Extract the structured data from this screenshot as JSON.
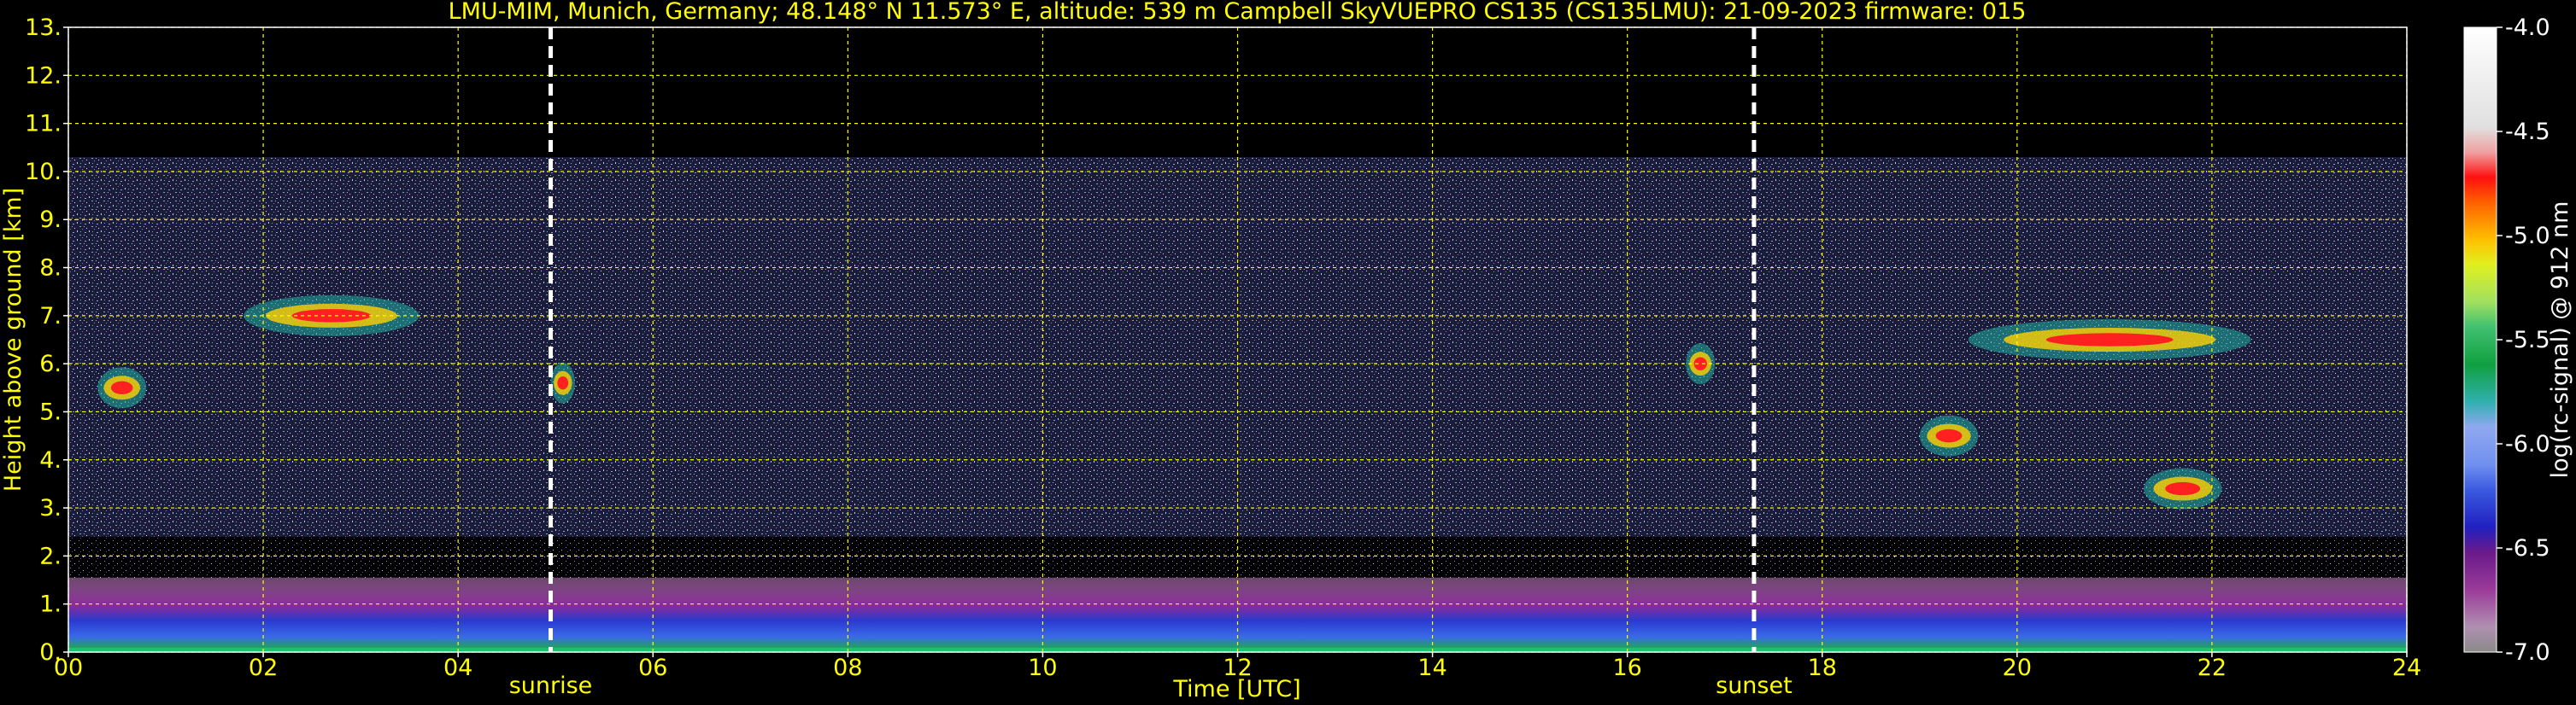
{
  "chart_data": {
    "type": "heatmap",
    "title": "LMU-MIM, Munich, Germany; 48.148° N 11.573° E, altitude: 539 m    Campbell SkyVUEPRO CS135 (CS135LMU): 21-09-2023    firmware: 015",
    "xlabel": "Time [UTC]",
    "ylabel": "Height above ground [km]",
    "xlim": [
      0,
      24
    ],
    "ylim": [
      0,
      13
    ],
    "x_ticks": [
      "00",
      "02",
      "04",
      "06",
      "08",
      "10",
      "12",
      "14",
      "16",
      "18",
      "20",
      "22",
      "24"
    ],
    "y_ticks": [
      "0.",
      "1.",
      "2.",
      "3.",
      "4.",
      "5.",
      "6.",
      "7.",
      "8.",
      "9.",
      "10.",
      "11.",
      "12.",
      "13."
    ],
    "grid": true,
    "grid_color": "#ffff00",
    "signal_top_km": 10.3,
    "markers": [
      {
        "label": "sunrise",
        "time_h": 4.95
      },
      {
        "label": "sunset",
        "time_h": 17.3
      }
    ],
    "colorbar": {
      "label": "log(rc-signal) @ 912 nm",
      "range": [
        -7.0,
        -4.0
      ],
      "ticks": [
        "-4.0",
        "-4.5",
        "-5.0",
        "-5.5",
        "-6.0",
        "-6.5",
        "-7.0"
      ]
    },
    "features": [
      {
        "kind": "cloud",
        "t_start": 0.3,
        "t_end": 0.8,
        "h_km": 5.5
      },
      {
        "kind": "cloud",
        "t_start": 1.8,
        "t_end": 3.6,
        "h_km": 7.0
      },
      {
        "kind": "cloud",
        "t_start": 4.95,
        "t_end": 5.2,
        "h_km": 5.6
      },
      {
        "kind": "cloud",
        "t_start": 16.6,
        "t_end": 16.9,
        "h_km": 6.0
      },
      {
        "kind": "cloud",
        "t_start": 19.5,
        "t_end": 22.4,
        "h_km": 6.5
      },
      {
        "kind": "cloud",
        "t_start": 21.3,
        "t_end": 22.1,
        "h_km": 3.4
      },
      {
        "kind": "cloud",
        "t_start": 19.0,
        "t_end": 19.6,
        "h_km": 4.5
      }
    ]
  }
}
